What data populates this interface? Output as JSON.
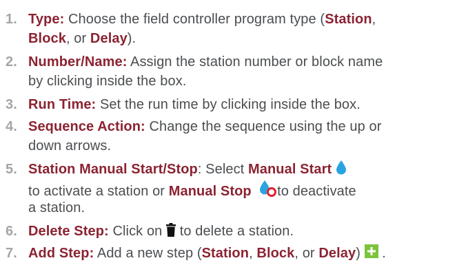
{
  "items": [
    {
      "number": "1.",
      "label": "Type:",
      "line1_pre": " Choose the field controller program type (",
      "opt1": "Station",
      "sep1": ",",
      "line2_opt2": "Block",
      "line2_mid": ", or ",
      "line2_opt3": "Delay",
      "line2_end": ")."
    },
    {
      "number": "2.",
      "label": "Number/Name:",
      "line1_text": " Assign the station number or block name",
      "line2_text": "by clicking inside the box."
    },
    {
      "number": "3.",
      "label": "Run Time:",
      "line1_text": " Set the run time by clicking inside the box."
    },
    {
      "number": "4.",
      "label": "Sequence Action:",
      "line1_text": " Change the sequence using the up or",
      "line2_text": "down arrows."
    },
    {
      "number": "5.",
      "label": "Station Manual Start/Stop",
      "line1_mid": ": Select ",
      "manual_start": "Manual Start",
      "line2_pre": "to activate a station or ",
      "manual_stop": "Manual Stop",
      "line2_post": "to deactivate",
      "line3_text": "a station."
    },
    {
      "number": "6.",
      "label": "Delete Step:",
      "line1_pre": " Click on ",
      "line1_post": " to delete a station."
    },
    {
      "number": "7.",
      "label": "Add Step:",
      "line1_pre": " Add a new step (",
      "opt1": "Station",
      "sep1": ", ",
      "opt2": "Block",
      "sep2": ", or ",
      "opt3": "Delay",
      "line1_end": ") ",
      "line1_tail": " ."
    }
  ],
  "colors": {
    "number": "#a3a6a9",
    "label": "#8b2332",
    "body": "#4a4d50",
    "drop": "#2aa4e0",
    "stop_ring": "#e0202c",
    "trash": "#111111",
    "plus_bg": "#7dc33b"
  },
  "icons": {
    "manual_start": "water-drop-icon",
    "manual_stop": "water-drop-stop-icon",
    "delete": "trash-icon",
    "add": "plus-icon"
  }
}
